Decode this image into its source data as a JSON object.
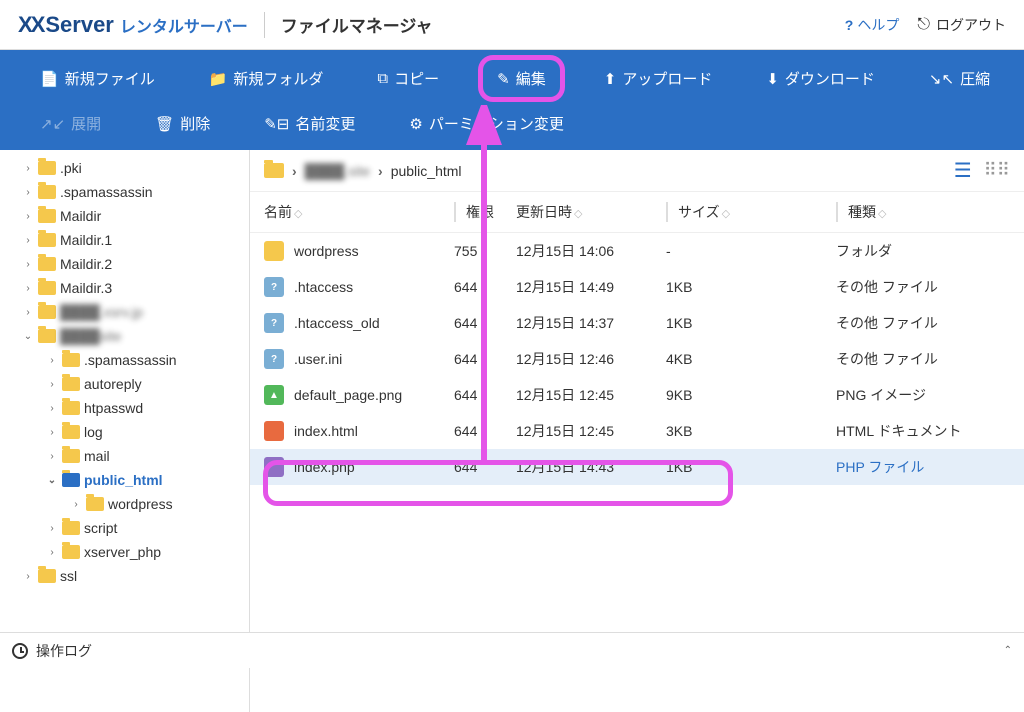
{
  "header": {
    "logo_main": "XServer",
    "logo_sub": "レンタルサーバー",
    "app_title": "ファイルマネージャ",
    "help": "ヘルプ",
    "logout": "ログアウト"
  },
  "toolbar": {
    "new_file": "新規ファイル",
    "new_folder": "新規フォルダ",
    "copy": "コピー",
    "edit": "編集",
    "upload": "アップロード",
    "download": "ダウンロード",
    "compress": "圧縮",
    "expand": "展開",
    "delete": "削除",
    "rename": "名前変更",
    "permission": "パーミッション変更"
  },
  "sidebar": {
    "items": [
      {
        "label": ".pki",
        "indent": 16,
        "caret": "›"
      },
      {
        "label": ".spamassassin",
        "indent": 16,
        "caret": "›"
      },
      {
        "label": "Maildir",
        "indent": 16,
        "caret": "›"
      },
      {
        "label": "Maildir.1",
        "indent": 16,
        "caret": "›"
      },
      {
        "label": "Maildir.2",
        "indent": 16,
        "caret": "›"
      },
      {
        "label": "Maildir.3",
        "indent": 16,
        "caret": "›"
      },
      {
        "label": ".xsrv.jp",
        "indent": 16,
        "caret": "›",
        "blurred": true,
        "prefix": "████"
      },
      {
        "label": "site",
        "indent": 16,
        "caret": "⌄",
        "blurred": true,
        "prefix": "████"
      },
      {
        "label": ".spamassassin",
        "indent": 40,
        "caret": "›"
      },
      {
        "label": "autoreply",
        "indent": 40,
        "caret": "›"
      },
      {
        "label": "htpasswd",
        "indent": 40,
        "caret": "›"
      },
      {
        "label": "log",
        "indent": 40,
        "caret": "›"
      },
      {
        "label": "mail",
        "indent": 40,
        "caret": "›"
      },
      {
        "label": "public_html",
        "indent": 40,
        "caret": "⌄",
        "selected": true
      },
      {
        "label": "wordpress",
        "indent": 64,
        "caret": "›"
      },
      {
        "label": "script",
        "indent": 40,
        "caret": "›"
      },
      {
        "label": "xserver_php",
        "indent": 40,
        "caret": "›"
      },
      {
        "label": "ssl",
        "indent": 16,
        "caret": "›"
      }
    ]
  },
  "breadcrumb": {
    "parts": [
      "████.site",
      "public_html"
    ]
  },
  "columns": {
    "name": "名前",
    "perm": "権限",
    "date": "更新日時",
    "size": "サイズ",
    "type": "種類"
  },
  "files": [
    {
      "name": "wordpress",
      "perm": "755",
      "date": "12月15日 14:06",
      "size": "-",
      "type": "フォルダ",
      "icon": "folder",
      "label": ""
    },
    {
      "name": ".htaccess",
      "perm": "644",
      "date": "12月15日 14:49",
      "size": "1KB",
      "type": "その他 ファイル",
      "icon": "unknown",
      "label": "?"
    },
    {
      "name": ".htaccess_old",
      "perm": "644",
      "date": "12月15日 14:37",
      "size": "1KB",
      "type": "その他 ファイル",
      "icon": "unknown",
      "label": "?"
    },
    {
      "name": ".user.ini",
      "perm": "644",
      "date": "12月15日 12:46",
      "size": "4KB",
      "type": "その他 ファイル",
      "icon": "unknown",
      "label": "?"
    },
    {
      "name": "default_page.png",
      "perm": "644",
      "date": "12月15日 12:45",
      "size": "9KB",
      "type": "PNG イメージ",
      "icon": "png",
      "label": "▲"
    },
    {
      "name": "index.html",
      "perm": "644",
      "date": "12月15日 12:45",
      "size": "3KB",
      "type": "HTML ドキュメント",
      "icon": "html",
      "label": "</>"
    },
    {
      "name": "index.php",
      "perm": "644",
      "date": "12月15日 14:43",
      "size": "1KB",
      "type": "PHP ファイル",
      "icon": "php",
      "label": "<?>",
      "selected": true
    }
  ],
  "footer": {
    "label": "操作ログ"
  }
}
